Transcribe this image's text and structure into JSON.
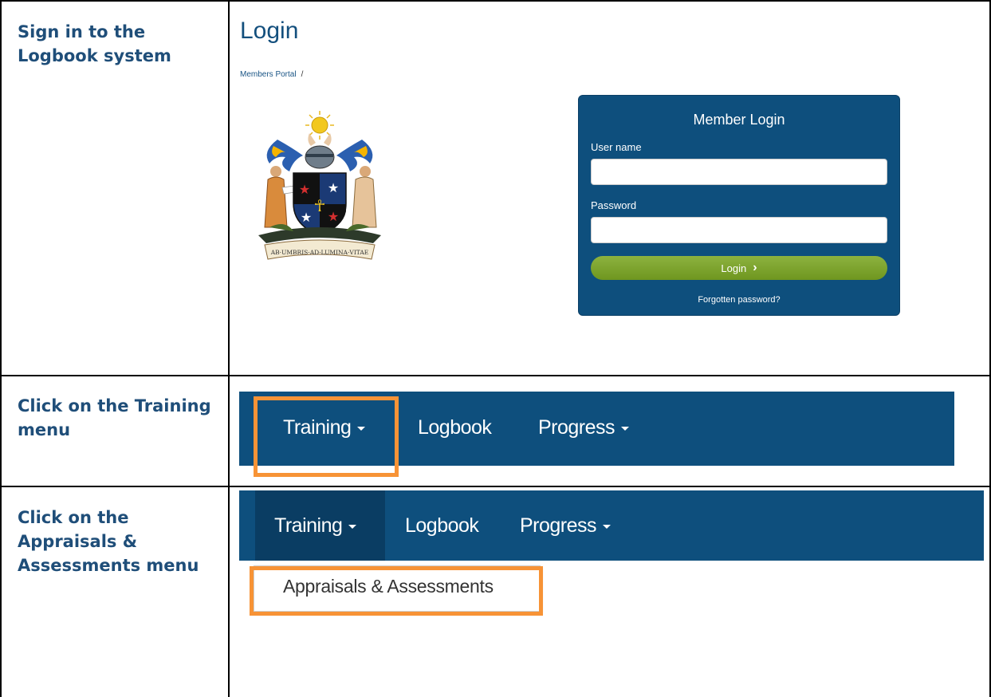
{
  "steps": [
    {
      "label": "Sign in to the Logbook system"
    },
    {
      "label": "Click on the Training menu"
    },
    {
      "label": "Click on the Appraisals & Assessments menu"
    }
  ],
  "login_page": {
    "title": "Login",
    "breadcrumb": {
      "link": "Members Portal",
      "separator": "/"
    },
    "crest": {
      "motto": "AB·UMBRIS·AD·LUMINA·VITAE"
    },
    "form": {
      "heading": "Member Login",
      "username_label": "User name",
      "username_value": "",
      "password_label": "Password",
      "password_value": "",
      "login_button": "Login",
      "forgot_link": "Forgotten password?"
    }
  },
  "nav": {
    "items": [
      {
        "label": "Training",
        "has_caret": true
      },
      {
        "label": "Logbook",
        "has_caret": false
      },
      {
        "label": "Progress",
        "has_caret": true
      }
    ],
    "dropdown": {
      "items": [
        "Appraisals & Assessments"
      ]
    }
  },
  "colors": {
    "nav_bg": "#0e4f7d",
    "highlight": "#f79336",
    "step_text": "#1f4e79",
    "login_button": "#7ea42f"
  }
}
